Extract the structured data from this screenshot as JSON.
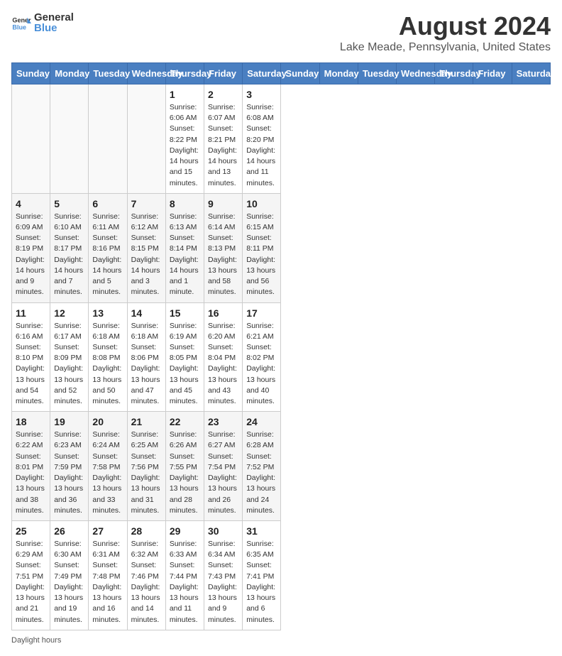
{
  "header": {
    "logo_general": "General",
    "logo_blue": "Blue",
    "title": "August 2024",
    "subtitle": "Lake Meade, Pennsylvania, United States"
  },
  "calendar": {
    "days_of_week": [
      "Sunday",
      "Monday",
      "Tuesday",
      "Wednesday",
      "Thursday",
      "Friday",
      "Saturday"
    ],
    "weeks": [
      [
        {
          "day": "",
          "info": ""
        },
        {
          "day": "",
          "info": ""
        },
        {
          "day": "",
          "info": ""
        },
        {
          "day": "",
          "info": ""
        },
        {
          "day": "1",
          "info": "Sunrise: 6:06 AM\nSunset: 8:22 PM\nDaylight: 14 hours\nand 15 minutes."
        },
        {
          "day": "2",
          "info": "Sunrise: 6:07 AM\nSunset: 8:21 PM\nDaylight: 14 hours\nand 13 minutes."
        },
        {
          "day": "3",
          "info": "Sunrise: 6:08 AM\nSunset: 8:20 PM\nDaylight: 14 hours\nand 11 minutes."
        }
      ],
      [
        {
          "day": "4",
          "info": "Sunrise: 6:09 AM\nSunset: 8:19 PM\nDaylight: 14 hours\nand 9 minutes."
        },
        {
          "day": "5",
          "info": "Sunrise: 6:10 AM\nSunset: 8:17 PM\nDaylight: 14 hours\nand 7 minutes."
        },
        {
          "day": "6",
          "info": "Sunrise: 6:11 AM\nSunset: 8:16 PM\nDaylight: 14 hours\nand 5 minutes."
        },
        {
          "day": "7",
          "info": "Sunrise: 6:12 AM\nSunset: 8:15 PM\nDaylight: 14 hours\nand 3 minutes."
        },
        {
          "day": "8",
          "info": "Sunrise: 6:13 AM\nSunset: 8:14 PM\nDaylight: 14 hours\nand 1 minute."
        },
        {
          "day": "9",
          "info": "Sunrise: 6:14 AM\nSunset: 8:13 PM\nDaylight: 13 hours\nand 58 minutes."
        },
        {
          "day": "10",
          "info": "Sunrise: 6:15 AM\nSunset: 8:11 PM\nDaylight: 13 hours\nand 56 minutes."
        }
      ],
      [
        {
          "day": "11",
          "info": "Sunrise: 6:16 AM\nSunset: 8:10 PM\nDaylight: 13 hours\nand 54 minutes."
        },
        {
          "day": "12",
          "info": "Sunrise: 6:17 AM\nSunset: 8:09 PM\nDaylight: 13 hours\nand 52 minutes."
        },
        {
          "day": "13",
          "info": "Sunrise: 6:18 AM\nSunset: 8:08 PM\nDaylight: 13 hours\nand 50 minutes."
        },
        {
          "day": "14",
          "info": "Sunrise: 6:18 AM\nSunset: 8:06 PM\nDaylight: 13 hours\nand 47 minutes."
        },
        {
          "day": "15",
          "info": "Sunrise: 6:19 AM\nSunset: 8:05 PM\nDaylight: 13 hours\nand 45 minutes."
        },
        {
          "day": "16",
          "info": "Sunrise: 6:20 AM\nSunset: 8:04 PM\nDaylight: 13 hours\nand 43 minutes."
        },
        {
          "day": "17",
          "info": "Sunrise: 6:21 AM\nSunset: 8:02 PM\nDaylight: 13 hours\nand 40 minutes."
        }
      ],
      [
        {
          "day": "18",
          "info": "Sunrise: 6:22 AM\nSunset: 8:01 PM\nDaylight: 13 hours\nand 38 minutes."
        },
        {
          "day": "19",
          "info": "Sunrise: 6:23 AM\nSunset: 7:59 PM\nDaylight: 13 hours\nand 36 minutes."
        },
        {
          "day": "20",
          "info": "Sunrise: 6:24 AM\nSunset: 7:58 PM\nDaylight: 13 hours\nand 33 minutes."
        },
        {
          "day": "21",
          "info": "Sunrise: 6:25 AM\nSunset: 7:56 PM\nDaylight: 13 hours\nand 31 minutes."
        },
        {
          "day": "22",
          "info": "Sunrise: 6:26 AM\nSunset: 7:55 PM\nDaylight: 13 hours\nand 28 minutes."
        },
        {
          "day": "23",
          "info": "Sunrise: 6:27 AM\nSunset: 7:54 PM\nDaylight: 13 hours\nand 26 minutes."
        },
        {
          "day": "24",
          "info": "Sunrise: 6:28 AM\nSunset: 7:52 PM\nDaylight: 13 hours\nand 24 minutes."
        }
      ],
      [
        {
          "day": "25",
          "info": "Sunrise: 6:29 AM\nSunset: 7:51 PM\nDaylight: 13 hours\nand 21 minutes."
        },
        {
          "day": "26",
          "info": "Sunrise: 6:30 AM\nSunset: 7:49 PM\nDaylight: 13 hours\nand 19 minutes."
        },
        {
          "day": "27",
          "info": "Sunrise: 6:31 AM\nSunset: 7:48 PM\nDaylight: 13 hours\nand 16 minutes."
        },
        {
          "day": "28",
          "info": "Sunrise: 6:32 AM\nSunset: 7:46 PM\nDaylight: 13 hours\nand 14 minutes."
        },
        {
          "day": "29",
          "info": "Sunrise: 6:33 AM\nSunset: 7:44 PM\nDaylight: 13 hours\nand 11 minutes."
        },
        {
          "day": "30",
          "info": "Sunrise: 6:34 AM\nSunset: 7:43 PM\nDaylight: 13 hours\nand 9 minutes."
        },
        {
          "day": "31",
          "info": "Sunrise: 6:35 AM\nSunset: 7:41 PM\nDaylight: 13 hours\nand 6 minutes."
        }
      ]
    ]
  },
  "footer": {
    "note": "Daylight hours"
  }
}
